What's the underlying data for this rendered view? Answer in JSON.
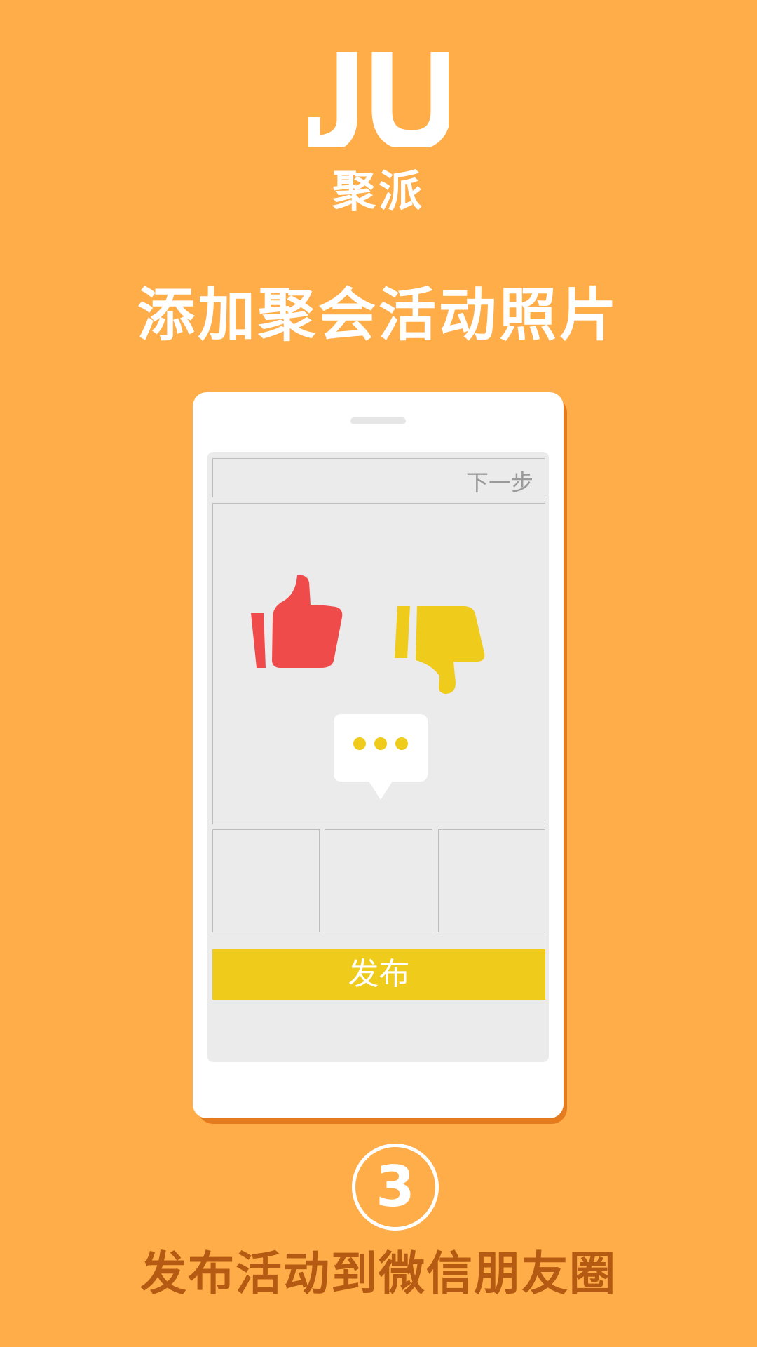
{
  "logo": {
    "mark": "JU",
    "name": "聚派"
  },
  "headline": "添加聚会活动照片",
  "phone": {
    "top_bar": {
      "next_label": "下一步"
    },
    "main_photo": {
      "icons": [
        "thumbs-up-icon",
        "thumbs-down-icon",
        "speech-bubble-icon"
      ]
    },
    "thumbnails": [
      "",
      "",
      ""
    ],
    "publish_label": "发布"
  },
  "step": {
    "number": "3",
    "caption": "发布活动到微信朋友圈"
  },
  "colors": {
    "background": "#FFAD48",
    "publish": "#EFCB1C",
    "thumbs_up": "#F04B4B",
    "thumbs_down": "#EFCB1C",
    "caption": "#B45A12"
  }
}
